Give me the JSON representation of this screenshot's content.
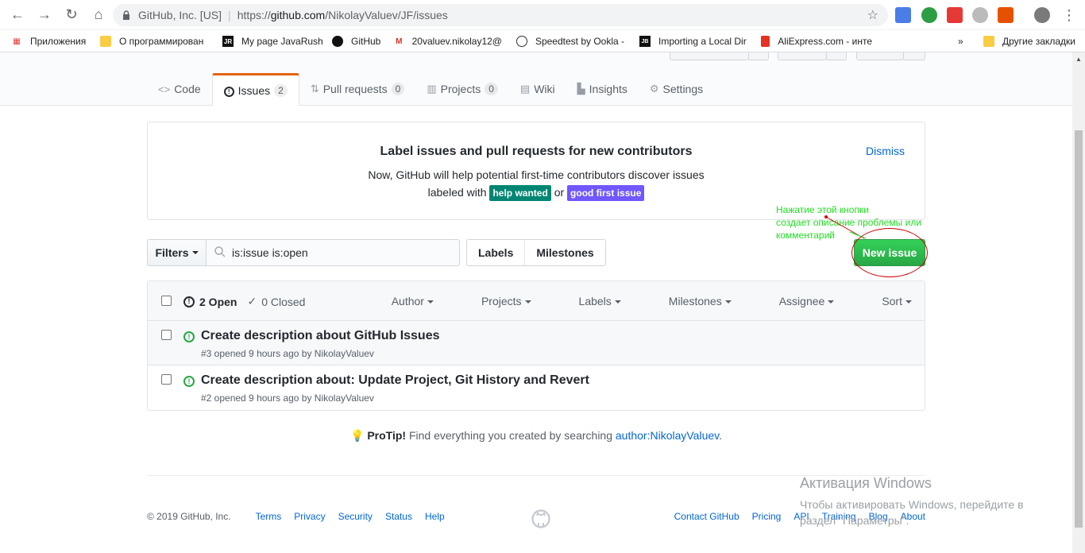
{
  "browser": {
    "site_label": "GitHub, Inc. [US]",
    "url_prefix": "https://",
    "url_host": "github.com",
    "url_path": "/NikolayValuev/JF/issues",
    "bookmarks": [
      "Приложения",
      "О программирован",
      "My page JavaRush",
      "GitHub",
      "20valuev.nikolay12@",
      "Speedtest by Ookla -",
      "Importing a Local Dir",
      "AliExpress.com - инте",
      "Другие закладки"
    ],
    "overflow": "»"
  },
  "tabs": [
    {
      "label": "Code",
      "icon": "code-icon"
    },
    {
      "label": "Issues",
      "count": "2",
      "icon": "issue-opened-icon"
    },
    {
      "label": "Pull requests",
      "count": "0",
      "icon": "git-pull-request-icon"
    },
    {
      "label": "Projects",
      "count": "0",
      "icon": "project-icon"
    },
    {
      "label": "Wiki",
      "icon": "book-icon"
    },
    {
      "label": "Insights",
      "icon": "graph-icon"
    },
    {
      "label": "Settings",
      "icon": "gear-icon"
    }
  ],
  "banner": {
    "title": "Label issues and pull requests for new contributors",
    "line1": "Now, GitHub will help potential first-time contributors discover issues",
    "line2_prefix": "labeled with",
    "label_help": "help wanted",
    "line2_or": "or",
    "label_good": "good first issue",
    "dismiss": "Dismiss",
    "colors": {
      "help_wanted": "#008672",
      "good_first_issue": "#7057ff"
    }
  },
  "subnav": {
    "filters": "Filters",
    "search_value": "is:issue is:open",
    "labels": "Labels",
    "milestones": "Milestones",
    "new_issue": "New issue"
  },
  "issues": {
    "open_count": "2 Open",
    "closed_count": "0 Closed",
    "filters": [
      "Author",
      "Projects",
      "Labels",
      "Milestones",
      "Assignee",
      "Sort"
    ],
    "rows": [
      {
        "title": "Create description about GitHub Issues",
        "meta": "#3 opened 9 hours ago by NikolayValuev"
      },
      {
        "title": "Create description about: Update Project, Git History and Revert",
        "meta": "#2 opened 9 hours ago by NikolayValuev"
      }
    ]
  },
  "protip": {
    "label": "ProTip!",
    "text": " Find everything you created by searching ",
    "link": "author:NikolayValuev",
    "end": "."
  },
  "footer": {
    "copyright": "© 2019 GitHub, Inc.",
    "left_links": [
      "Terms",
      "Privacy",
      "Security",
      "Status",
      "Help"
    ],
    "right_links": [
      "Contact GitHub",
      "Pricing",
      "API",
      "Training",
      "Blog",
      "About"
    ]
  },
  "annotation": {
    "lines": [
      "Нажатие этой кнопки",
      "создает описание проблемы или",
      "комментарий"
    ],
    "text_color": "#22dd22",
    "ellipse_color": "#cc0000"
  },
  "watermark": {
    "title": "Активация Windows",
    "line1": "Чтобы активировать Windows, перейдите в",
    "line2": "раздел \"Параметры\"."
  },
  "colors": {
    "accent": "#0366d6",
    "green": "#28a745",
    "tab_orange": "#e36209"
  }
}
